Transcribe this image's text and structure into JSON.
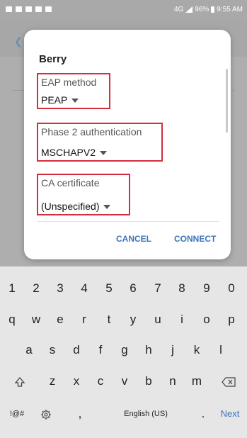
{
  "status_bar": {
    "time": "9:55 AM",
    "battery": "96%",
    "network": "4G"
  },
  "dialog": {
    "title": "Berry",
    "eap_method": {
      "label": "EAP method",
      "value": "PEAP"
    },
    "phase2": {
      "label": "Phase 2 authentication",
      "value": "MSCHAPV2"
    },
    "ca_certificate": {
      "label": "CA certificate",
      "value": "(Unspecified)"
    },
    "cancel_label": "CANCEL",
    "connect_label": "CONNECT"
  },
  "keyboard": {
    "number_row": [
      "1",
      "2",
      "3",
      "4",
      "5",
      "6",
      "7",
      "8",
      "9",
      "0"
    ],
    "row1": [
      "q",
      "w",
      "e",
      "r",
      "t",
      "y",
      "u",
      "i",
      "o",
      "p"
    ],
    "row2": [
      "a",
      "s",
      "d",
      "f",
      "g",
      "h",
      "j",
      "k",
      "l"
    ],
    "row3": [
      "z",
      "x",
      "c",
      "v",
      "b",
      "n",
      "m"
    ],
    "symbols_label": "!@#",
    "comma_label": ",",
    "space_label": "English (US)",
    "period_label": ".",
    "next_label": "Next",
    "shift_icon": "shift-arrow",
    "backspace_icon": "backspace",
    "settings_icon": "gear"
  },
  "colors": {
    "accent": "#3b74b8",
    "highlight_border": "#d32f3f"
  }
}
